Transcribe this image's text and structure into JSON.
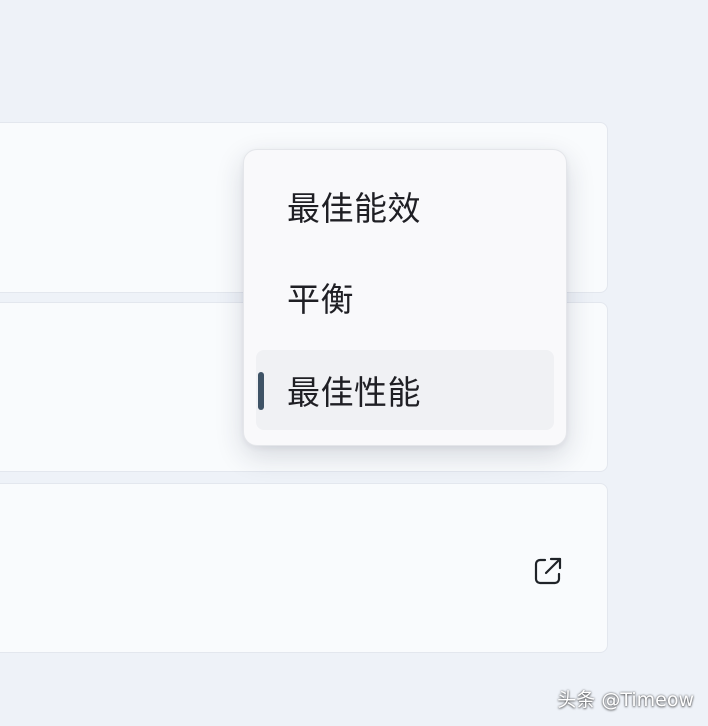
{
  "power_mode_menu": {
    "items": [
      {
        "label": "最佳能效",
        "selected": false
      },
      {
        "label": "平衡",
        "selected": false
      },
      {
        "label": "最佳性能",
        "selected": true
      }
    ]
  },
  "icons": {
    "external_link": "open-external-icon"
  },
  "colors": {
    "page_background": "#eef2f8",
    "card_background": "#f9fbfd",
    "flyout_background": "#f9f9fb",
    "selected_item_background": "#f0f1f4",
    "selection_indicator": "#3f5366",
    "text": "#1f1f24"
  },
  "watermark": "头条 @Timeow"
}
